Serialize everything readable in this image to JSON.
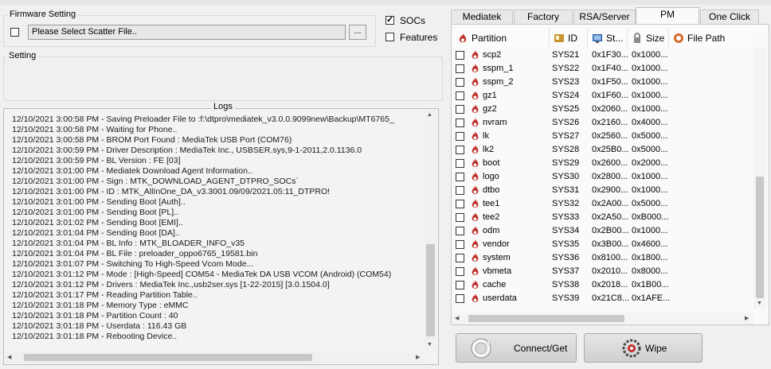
{
  "firmware": {
    "group_title": "Firmware Setting",
    "scatter_value": "Please Select Scatter File..",
    "browse_label": "...",
    "socs_label": "SOCs",
    "features_label": "Features"
  },
  "setting": {
    "group_title": "Setting"
  },
  "logs": {
    "title": "Logs",
    "lines": [
      "12/10/2021 3:00:58 PM - Saving Preloader File to :f:\\dtpro\\mediatek_v3.0.0.9099new\\Backup\\MT6765_",
      "12/10/2021 3:00:58 PM - Waiting for Phone..",
      "12/10/2021 3:00:58 PM - BROM Port Found : MediaTek USB Port (COM76)",
      "12/10/2021 3:00:59 PM - Driver Description : MediaTek Inc., USBSER.sys,9-1-2011,2.0.1136.0",
      "12/10/2021 3:00:59 PM - BL Version : FE [03]",
      "12/10/2021 3:01:00 PM - Mediatek Download Agent Information..",
      "12/10/2021 3:01:00 PM - Sign : MTK_DOWNLOAD_AGENT_DTPRO_SOCs`",
      "12/10/2021 3:01:00 PM - ID : MTK_AllInOne_DA_v3.3001.09/09/2021.05:11_DTPRO!",
      "12/10/2021 3:01:00 PM - Sending Boot [Auth]..",
      "12/10/2021 3:01:00 PM - Sending Boot [PL]..",
      "12/10/2021 3:01:02 PM - Sending Boot [EMI]..",
      "12/10/2021 3:01:04 PM - Sending Boot [DA]..",
      "12/10/2021 3:01:04 PM - BL Info : MTK_BLOADER_INFO_v35",
      "12/10/2021 3:01:04 PM - BL File : preloader_oppo6765_19581.bin",
      "12/10/2021 3:01:07 PM - Switching To High-Speed Vcom Mode...",
      "12/10/2021 3:01:12 PM - Mode : [High-Speed] COM54 - MediaTek DA USB VCOM (Android) (COM54)",
      "12/10/2021 3:01:12 PM - Drivers : MediaTek Inc.,usb2ser.sys [1-22-2015] [3.0.1504.0]",
      "12/10/2021 3:01:17 PM - Reading Partition Table..",
      "12/10/2021 3:01:18 PM - Memory Type : eMMC",
      "12/10/2021 3:01:18 PM - Partition Count : 40",
      "12/10/2021 3:01:18 PM - Userdata : 116.43 GB",
      "12/10/2021 3:01:18 PM - Rebooting Device.."
    ]
  },
  "tabs": [
    "Mediatek",
    "Factory",
    "RSA/Server",
    "PM",
    "One Click"
  ],
  "active_tab": "PM",
  "table": {
    "headers": {
      "partition": "Partition",
      "id": "ID",
      "start": "St...",
      "size": "Size",
      "path": "File Path"
    },
    "rows": [
      {
        "name": "scp2",
        "id": "SYS21",
        "start": "0x1F30...",
        "size": "0x1000..."
      },
      {
        "name": "sspm_1",
        "id": "SYS22",
        "start": "0x1F40...",
        "size": "0x1000..."
      },
      {
        "name": "sspm_2",
        "id": "SYS23",
        "start": "0x1F50...",
        "size": "0x1000..."
      },
      {
        "name": "gz1",
        "id": "SYS24",
        "start": "0x1F60...",
        "size": "0x1000..."
      },
      {
        "name": "gz2",
        "id": "SYS25",
        "start": "0x2060...",
        "size": "0x1000..."
      },
      {
        "name": "nvram",
        "id": "SYS26",
        "start": "0x2160...",
        "size": "0x4000..."
      },
      {
        "name": "lk",
        "id": "SYS27",
        "start": "0x2560...",
        "size": "0x5000..."
      },
      {
        "name": "lk2",
        "id": "SYS28",
        "start": "0x25B0...",
        "size": "0x5000..."
      },
      {
        "name": "boot",
        "id": "SYS29",
        "start": "0x2600...",
        "size": "0x2000..."
      },
      {
        "name": "logo",
        "id": "SYS30",
        "start": "0x2800...",
        "size": "0x1000..."
      },
      {
        "name": "dtbo",
        "id": "SYS31",
        "start": "0x2900...",
        "size": "0x1000..."
      },
      {
        "name": "tee1",
        "id": "SYS32",
        "start": "0x2A00...",
        "size": "0x5000..."
      },
      {
        "name": "tee2",
        "id": "SYS33",
        "start": "0x2A50...",
        "size": "0xB000..."
      },
      {
        "name": "odm",
        "id": "SYS34",
        "start": "0x2B00...",
        "size": "0x1000..."
      },
      {
        "name": "vendor",
        "id": "SYS35",
        "start": "0x3B00...",
        "size": "0x4600..."
      },
      {
        "name": "system",
        "id": "SYS36",
        "start": "0x8100...",
        "size": "0x1800..."
      },
      {
        "name": "vbmeta",
        "id": "SYS37",
        "start": "0x2010...",
        "size": "0x8000..."
      },
      {
        "name": "cache",
        "id": "SYS38",
        "start": "0x2018...",
        "size": "0x1B00..."
      },
      {
        "name": "userdata",
        "id": "SYS39",
        "start": "0x21C8...",
        "size": "0x1AFE..."
      }
    ]
  },
  "buttons": {
    "connect": "Connect/Get",
    "wipe": "Wipe"
  },
  "colors": {
    "flame": "#c0302a",
    "accent": "#3a6fb0"
  }
}
